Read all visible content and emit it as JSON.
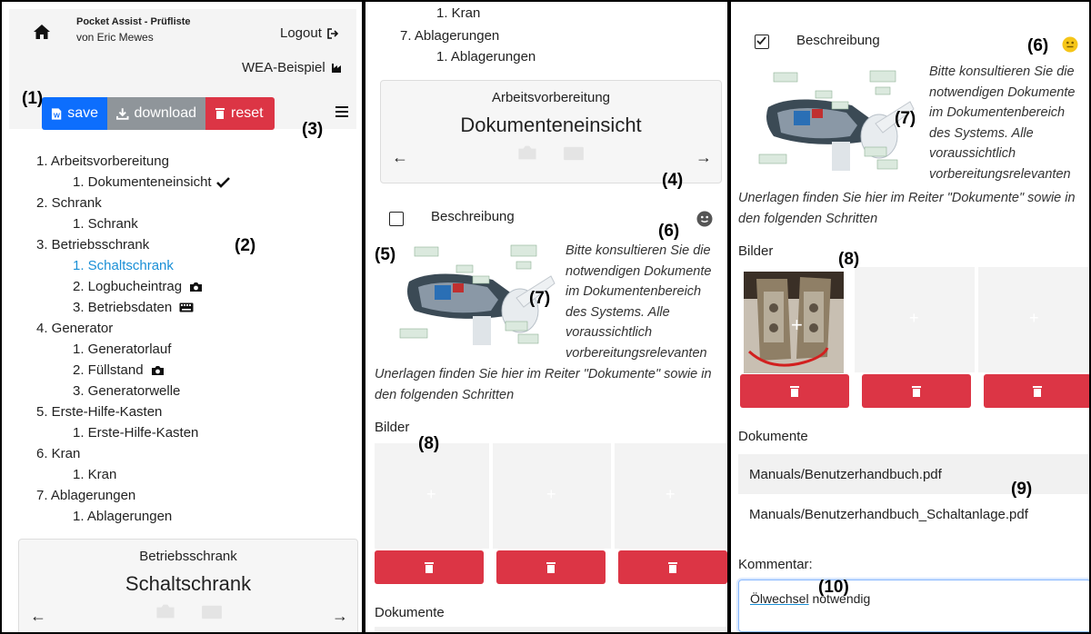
{
  "app": {
    "title": "Pocket Assist - Prüfliste",
    "author": "von Eric Mewes",
    "logout_label": "Logout",
    "project_label": "WEA-Beispiel"
  },
  "toolbar": {
    "save_label": "save",
    "download_label": "download",
    "reset_label": "reset"
  },
  "callouts": [
    "(1)",
    "(2)",
    "(3)",
    "(4)",
    "(5)",
    "(6)",
    "(7)",
    "(8)",
    "(9)",
    "(10)"
  ],
  "nav_tree": [
    {
      "label": "1. Arbeitsvorbereitung",
      "children": [
        {
          "label": "1. Dokumenteneinsicht",
          "done": true
        }
      ]
    },
    {
      "label": "2. Schrank",
      "children": [
        {
          "label": "1. Schrank"
        }
      ]
    },
    {
      "label": "3. Betriebsschrank",
      "children": [
        {
          "label": "1. Schaltschrank",
          "active": true
        },
        {
          "label": "2. Logbucheintrag",
          "icon": "camera-icon"
        },
        {
          "label": "3. Betriebsdaten",
          "icon": "keyboard-icon"
        }
      ]
    },
    {
      "label": "4. Generator",
      "children": [
        {
          "label": "1. Generatorlauf"
        },
        {
          "label": "2. Füllstand",
          "icon": "camera-icon"
        },
        {
          "label": "3. Generatorwelle"
        }
      ]
    },
    {
      "label": "5. Erste-Hilfe-Kasten",
      "children": [
        {
          "label": "1. Erste-Hilfe-Kasten"
        }
      ]
    },
    {
      "label": "6. Kran",
      "children": [
        {
          "label": "1. Kran"
        }
      ]
    },
    {
      "label": "7. Ablagerungen",
      "children": [
        {
          "label": "1. Ablagerungen"
        }
      ]
    }
  ],
  "panel1_card": {
    "subtitle": "Betriebsschrank",
    "title": "Schaltschrank"
  },
  "panel2_top": {
    "kran_child": "1. Kran",
    "ablag": "7. Ablagerungen",
    "ablag_child": "1. Ablagerungen"
  },
  "panel2_card": {
    "subtitle": "Arbeitsvorbereitung",
    "title": "Dokumenteneinsicht"
  },
  "task": {
    "description_label": "Beschreibung",
    "description_text_right": [
      "Bitte konsultieren Sie die",
      "notwendigen Dokumente",
      "im Dokumentenbereich",
      "des Systems. Alle",
      "voraussichtlich",
      "vorbereitungsrelevanten"
    ],
    "description_text_full": [
      "Unerlagen finden Sie hier im Reiter \"Dokumente\" sowie in",
      "den folgenden Schritten"
    ],
    "images_label": "Bilder",
    "documents_label": "Dokumente",
    "documents": [
      "Manuals/Benutzerhandbuch.pdf",
      "Manuals/Benutzerhandbuch_Schaltanlage.pdf"
    ],
    "comment_label": "Kommentar:",
    "comment_underlined": "Ölwechsel",
    "comment_rest": "notwendig"
  },
  "colors": {
    "primary": "#0d6efd",
    "secondary": "#6c757d",
    "danger": "#dc3545",
    "active_link": "#1a8fd6",
    "smiley_yellow": "#f5c518"
  }
}
